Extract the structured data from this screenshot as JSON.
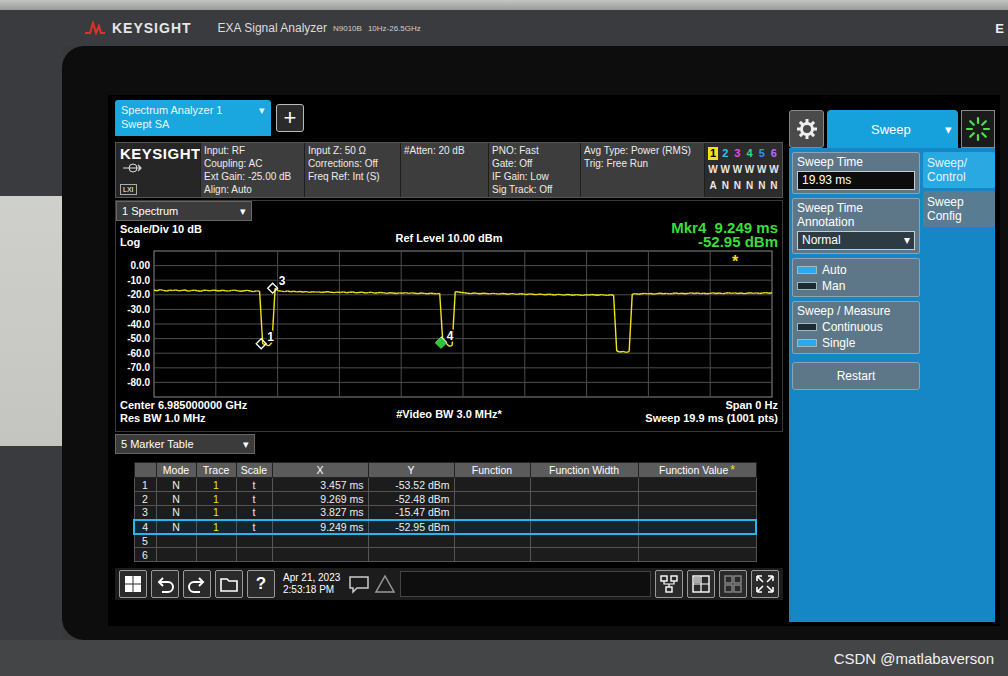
{
  "device": {
    "brand": "KEYSIGHT",
    "model": "EXA Signal Analyzer",
    "number": "N9010B",
    "range": "10Hz-26.5GHz",
    "edge_label": "E"
  },
  "app_tab": {
    "title": "Spectrum Analyzer 1",
    "subtitle": "Swept SA",
    "arrow": "▾",
    "add": "+"
  },
  "info": {
    "logo": "KEYSIGHT",
    "logo_sub": "LXI",
    "columns": [
      [
        "Input: RF",
        "Coupling: AC",
        "Ext Gain: -25.00 dB",
        "Align: Auto"
      ],
      [
        "Input Z: 50 Ω",
        "Corrections: Off",
        "Freq Ref: Int (S)"
      ],
      [
        "#Atten: 20 dB"
      ],
      [
        "PNO: Fast",
        "Gate: Off",
        "IF Gain: Low",
        "Sig Track: Off"
      ],
      [
        "Avg Type: Power (RMS)",
        "Trig: Free Run"
      ]
    ],
    "traces": [
      {
        "number": "1",
        "type": "W",
        "detector": "A",
        "color": "#f2e21c",
        "selected": true
      },
      {
        "number": "2",
        "type": "W",
        "detector": "N",
        "color": "#2cc5ee",
        "selected": false
      },
      {
        "number": "3",
        "type": "W",
        "detector": "N",
        "color": "#e44ce6",
        "selected": false
      },
      {
        "number": "4",
        "type": "W",
        "detector": "N",
        "color": "#3fd48a",
        "selected": false
      },
      {
        "number": "5",
        "type": "W",
        "detector": "N",
        "color": "#3c8cff",
        "selected": false
      },
      {
        "number": "6",
        "type": "W",
        "detector": "N",
        "color": "#b86cf2",
        "selected": false
      }
    ]
  },
  "window_select": {
    "label": "1 Spectrum",
    "arrow": "▾"
  },
  "chart": {
    "scale": "Scale/Div 10 dB",
    "log": "Log",
    "ref": "Ref Level 10.00 dBm",
    "marker_readout": {
      "label": "Mkr4  9.249 ms",
      "value": "-52.95 dBm"
    },
    "y_ticks": [
      "0.00",
      "-10.0",
      "-20.0",
      "-30.0",
      "-40.0",
      "-50.0",
      "-60.0",
      "-70.0",
      "-80.0"
    ],
    "star": "*",
    "footer": {
      "center": "Center 6.985000000 GHz",
      "rbw": "Res BW 1.0 MHz",
      "vbw": "#Video BW 3.0 MHz*",
      "span": "Span 0 Hz",
      "sweep": "Sweep 19.9 ms (1001 pts)"
    },
    "series": [
      {
        "name": "Trace 1",
        "color": "#f2e21c",
        "values": [
          -16.8,
          -17.2,
          -16.5,
          -17.0,
          -17.4,
          -16.9,
          -17.1,
          -16.6,
          -17.3,
          -17.0,
          -16.7,
          -17.5,
          -17.1,
          -16.8,
          -17.2,
          -17.6,
          -16.9,
          -17.0,
          -17.3,
          -16.8,
          -17.1,
          -17.4,
          -16.9,
          -17.2,
          -17.5,
          -17.0,
          -16.8,
          -17.3,
          -17.6,
          -17.2,
          -17.0,
          -17.4,
          -17.8,
          -17.3,
          -17.5,
          -53.5,
          -54.1,
          -55.0,
          -52.5,
          -15.5,
          -17.2,
          -17.5,
          -17.8,
          -17.4,
          -17.9,
          -17.6,
          -18.0,
          -17.7,
          -18.1,
          -17.8,
          -18.3,
          -17.9,
          -18.2,
          -18.0,
          -18.4,
          -18.1,
          -17.9,
          -18.3,
          -18.5,
          -18.2,
          -18.4,
          -18.0,
          -18.6,
          -18.3,
          -18.1,
          -18.7,
          -18.4,
          -18.2,
          -18.8,
          -18.5,
          -18.3,
          -18.9,
          -18.6,
          -18.4,
          -18.7,
          -19.0,
          -18.6,
          -18.8,
          -19.1,
          -18.7,
          -18.9,
          -18.5,
          -19.0,
          -18.7,
          -18.9,
          -19.2,
          -18.8,
          -19.0,
          -19.3,
          -18.9,
          -19.1,
          -19.4,
          -19.0,
          -52.5,
          -53.0,
          -55.2,
          -54.8,
          -17.8,
          -18.1,
          -18.4,
          -18.6,
          -18.9,
          -19.2,
          -18.8,
          -19.0,
          -19.3,
          -18.9,
          -19.1,
          -19.4,
          -19.0,
          -19.2,
          -19.5,
          -19.1,
          -19.3,
          -19.6,
          -19.2,
          -19.4,
          -19.7,
          -19.3,
          -19.5,
          -19.8,
          -19.4,
          -19.6,
          -19.9,
          -19.5,
          -19.7,
          -20.0,
          -19.6,
          -19.8,
          -20.1,
          -19.7,
          -19.9,
          -20.2,
          -19.8,
          -20.0,
          -20.3,
          -19.9,
          -20.1,
          -20.4,
          -20.0,
          -20.2,
          -19.8,
          -20.1,
          -20.3,
          -19.9,
          -20.2,
          -20.4,
          -20.0,
          -20.3,
          -58.5,
          -59.2,
          -58.8,
          -59.4,
          -58.9,
          -19.5,
          -19.2,
          -19.6,
          -19.3,
          -19.0,
          -19.4,
          -19.1,
          -19.5,
          -19.2,
          -18.9,
          -19.3,
          -19.0,
          -19.4,
          -19.1,
          -18.8,
          -19.2,
          -18.9,
          -19.3,
          -19.0,
          -18.7,
          -19.1,
          -18.8,
          -19.2,
          -18.9,
          -19.3,
          -19.0,
          -18.7,
          -19.1,
          -18.8,
          -19.2,
          -18.9,
          -18.6,
          -19.0,
          -18.7,
          -19.1,
          -18.8,
          -19.2,
          -18.9,
          -18.6,
          -19.0,
          -18.7,
          -19.1,
          -18.8,
          -18.5,
          -18.9,
          -18.6
        ]
      }
    ]
  },
  "marker_table": {
    "title": "5 Marker Table",
    "arrow": "▾",
    "star": "*",
    "columns": [
      "",
      "Mode",
      "Trace",
      "Scale",
      "X",
      "Y",
      "Function",
      "Function Width",
      "Function Value"
    ],
    "rows": [
      {
        "number": "1",
        "mode": "N",
        "trace": "1",
        "scale": "t",
        "x": "3.457 ms",
        "y": "-53.52 dBm",
        "function": "",
        "function_width": "",
        "function_value": "",
        "selected": false,
        "label_shown": true
      },
      {
        "number": "2",
        "mode": "N",
        "trace": "1",
        "scale": "t",
        "x": "9.269 ms",
        "y": "-52.48 dBm",
        "function": "",
        "function_width": "",
        "function_value": "",
        "selected": false,
        "label_shown": false
      },
      {
        "number": "3",
        "mode": "N",
        "trace": "1",
        "scale": "t",
        "x": "3.827 ms",
        "y": "-15.47 dBm",
        "function": "",
        "function_width": "",
        "function_value": "",
        "selected": false,
        "label_shown": true
      },
      {
        "number": "4",
        "mode": "N",
        "trace": "1",
        "scale": "t",
        "x": "9.249 ms",
        "y": "-52.95 dBm",
        "function": "",
        "function_width": "",
        "function_value": "",
        "selected": true,
        "label_shown": true
      },
      {
        "number": "5",
        "mode": "",
        "trace": "",
        "scale": "",
        "x": "",
        "y": "",
        "function": "",
        "function_width": "",
        "function_value": "",
        "selected": false,
        "label_shown": false
      },
      {
        "number": "6",
        "mode": "",
        "trace": "",
        "scale": "",
        "x": "",
        "y": "",
        "function": "",
        "function_width": "",
        "function_value": "",
        "selected": false,
        "label_shown": false
      }
    ]
  },
  "taskbar": {
    "help": "?",
    "date": "Apr 21, 2023",
    "time": "2:53:18 PM"
  },
  "side": {
    "tab": {
      "label": "Sweep",
      "arrow": "▾"
    },
    "tabs": [
      {
        "label": "Sweep/ Control",
        "selected": true
      },
      {
        "label": "Sweep Config",
        "selected": false
      }
    ],
    "sweep_time": {
      "label": "Sweep Time",
      "value": "19.93 ms"
    },
    "annotation": {
      "label": "Sweep Time Annotation",
      "value": "Normal",
      "arrow": "▾"
    },
    "auto_man": [
      {
        "label": "Auto",
        "selected": true
      },
      {
        "label": "Man",
        "selected": false
      }
    ],
    "sweep_measure": {
      "label": "Sweep / Measure",
      "options": [
        {
          "label": "Continuous",
          "selected": false
        },
        {
          "label": "Single",
          "selected": true
        }
      ]
    },
    "restart": "Restart"
  },
  "watermark": "CSDN @matlabaverson"
}
